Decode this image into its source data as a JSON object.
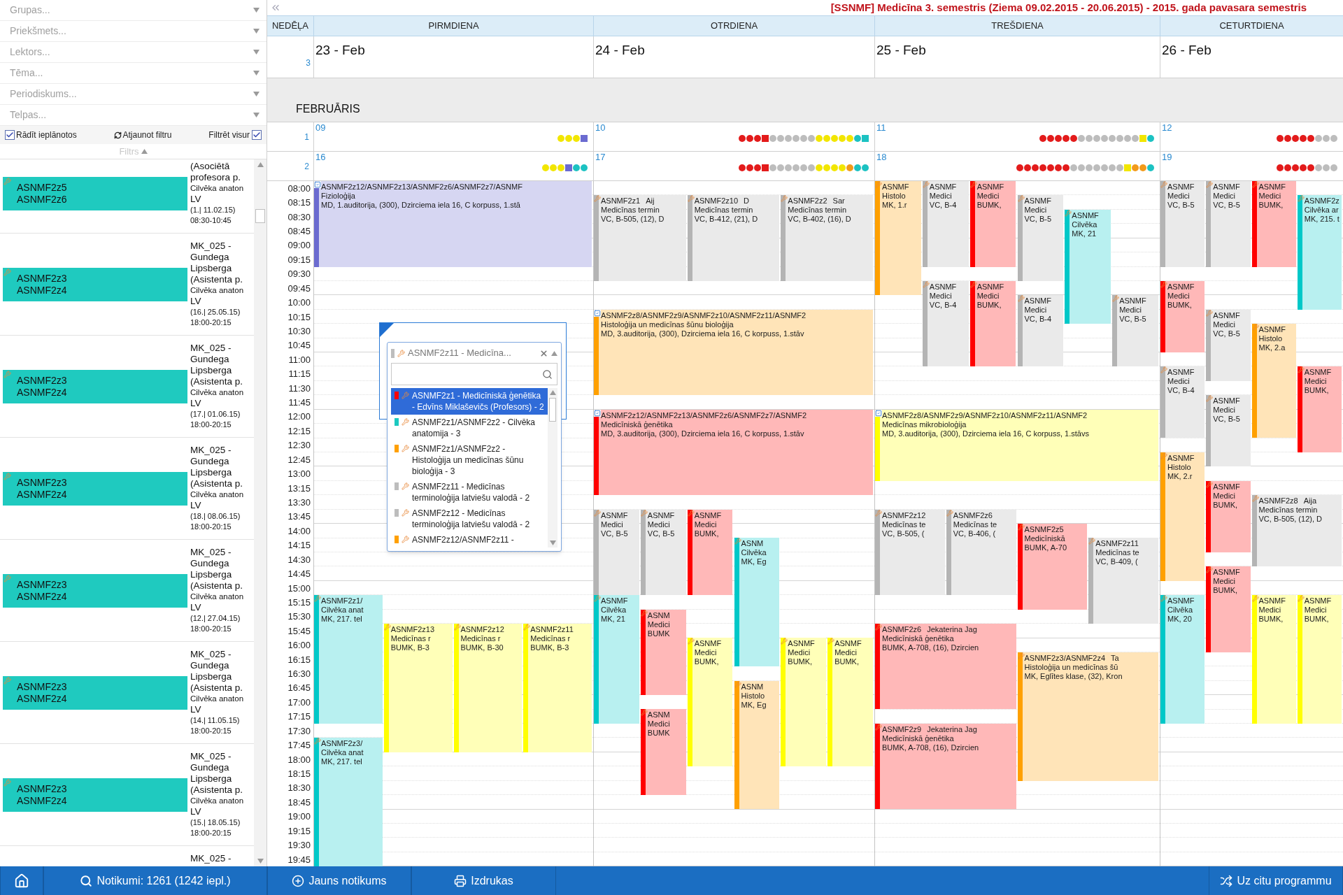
{
  "sidebar": {
    "filters": [
      {
        "placeholder": "Grupas..."
      },
      {
        "placeholder": "Priekšmets..."
      },
      {
        "placeholder": "Lektors..."
      },
      {
        "placeholder": "Tēma..."
      },
      {
        "placeholder": "Periodiskums..."
      },
      {
        "placeholder": "Telpas..."
      }
    ],
    "show_planned": {
      "label": "Rādīt ieplānotos",
      "checked": true
    },
    "refresh": {
      "label": "Atjaunot filtru"
    },
    "filter_everywhere": {
      "label": "Filtrēt visur",
      "checked": true
    },
    "filter_toggle": {
      "label": "Filtrs",
      "expanded": true
    },
    "events": [
      {
        "groups": [
          "ASNMF2z5",
          "ASNMF2z6"
        ],
        "header": [
          "(Asociētā",
          "profesora p."
        ],
        "subject": "Cilvēka anaton",
        "lang": "LV",
        "date": "(1.| 11.02.15)",
        "time": "08:30-10:45"
      },
      {
        "groups": [
          "ASNMF2z3",
          "ASNMF2z4"
        ],
        "header": [
          "MK_025 -",
          "Gundega",
          "Lipsberga",
          "(Asistenta p."
        ],
        "subject": "Cilvēka anaton",
        "lang": "LV",
        "date": "(16.| 25.05.15)",
        "time": "18:00-20:15"
      },
      {
        "groups": [
          "ASNMF2z3",
          "ASNMF2z4"
        ],
        "header": [
          "MK_025 -",
          "Gundega",
          "Lipsberga",
          "(Asistenta p."
        ],
        "subject": "Cilvēka anaton",
        "lang": "LV",
        "date": "(17.| 01.06.15)",
        "time": "18:00-20:15"
      },
      {
        "groups": [
          "ASNMF2z3",
          "ASNMF2z4"
        ],
        "header": [
          "MK_025 -",
          "Gundega",
          "Lipsberga",
          "(Asistenta p."
        ],
        "subject": "Cilvēka anaton",
        "lang": "LV",
        "date": "(18.| 08.06.15)",
        "time": "18:00-20:15"
      },
      {
        "groups": [
          "ASNMF2z3",
          "ASNMF2z4"
        ],
        "header": [
          "MK_025 -",
          "Gundega",
          "Lipsberga",
          "(Asistenta p."
        ],
        "subject": "Cilvēka anaton",
        "lang": "LV",
        "date": "(12.| 27.04.15)",
        "time": "18:00-20:15"
      },
      {
        "groups": [
          "ASNMF2z3",
          "ASNMF2z4"
        ],
        "header": [
          "MK_025 -",
          "Gundega",
          "Lipsberga",
          "(Asistenta p."
        ],
        "subject": "Cilvēka anaton",
        "lang": "LV",
        "date": "(14.| 11.05.15)",
        "time": "18:00-20:15"
      },
      {
        "groups": [
          "ASNMF2z3",
          "ASNMF2z4"
        ],
        "header": [
          "MK_025 -",
          "Gundega",
          "Lipsberga",
          "(Asistenta p."
        ],
        "subject": "Cilvēka anaton",
        "lang": "LV",
        "date": "(15.| 18.05.15)",
        "time": "18:00-20:15"
      },
      {
        "header": [
          "MK_025 -"
        ]
      }
    ]
  },
  "calendar": {
    "title": "[SSNMF] Medicīna 3. semestris (Ziema 09.02.2015 - 20.06.2015) - 2015. gada pavasara semestris",
    "week_header": "NEDĒĻA",
    "week_number": "3",
    "columns": [
      {
        "name": "PIRMDIENA",
        "date": "23 - Feb"
      },
      {
        "name": "OTRDIENA",
        "date": "24 - Feb"
      },
      {
        "name": "TREŠDIENA",
        "date": "25 - Feb"
      },
      {
        "name": "CETURTDIENA",
        "date": "26 - Feb"
      }
    ],
    "month": "FEBRUĀRIS",
    "weeks": [
      {
        "number": "1",
        "days": [
          {
            "date": "09",
            "dots": [
              {
                "color": "#f2e600",
                "kind": "circle"
              },
              {
                "color": "#f2e600",
                "kind": "circle"
              },
              {
                "color": "#f2e600",
                "kind": "circle"
              },
              {
                "color": "#6b6bd0",
                "kind": "square"
              }
            ]
          },
          {
            "date": "10",
            "dots": [
              {
                "color": "#e31b1b",
                "kind": "circle"
              },
              {
                "color": "#e31b1b",
                "kind": "circle"
              },
              {
                "color": "#e31b1b",
                "kind": "circle"
              },
              {
                "color": "#e31b1b",
                "kind": "square"
              },
              {
                "color": "#bdbdbd",
                "kind": "circle"
              },
              {
                "color": "#bdbdbd",
                "kind": "circle"
              },
              {
                "color": "#bdbdbd",
                "kind": "circle"
              },
              {
                "color": "#bdbdbd",
                "kind": "circle"
              },
              {
                "color": "#bdbdbd",
                "kind": "circle"
              },
              {
                "color": "#bdbdbd",
                "kind": "circle"
              },
              {
                "color": "#f2e600",
                "kind": "circle"
              },
              {
                "color": "#f2e600",
                "kind": "circle"
              },
              {
                "color": "#f2e600",
                "kind": "circle"
              },
              {
                "color": "#f2e600",
                "kind": "circle"
              },
              {
                "color": "#f2e600",
                "kind": "circle"
              },
              {
                "color": "#1cc2c2",
                "kind": "circle"
              },
              {
                "color": "#1cc2c2",
                "kind": "square"
              }
            ]
          },
          {
            "date": "11",
            "dots": [
              {
                "color": "#e31b1b",
                "kind": "circle"
              },
              {
                "color": "#e31b1b",
                "kind": "circle"
              },
              {
                "color": "#e31b1b",
                "kind": "circle"
              },
              {
                "color": "#e31b1b",
                "kind": "circle"
              },
              {
                "color": "#e31b1b",
                "kind": "circle"
              },
              {
                "color": "#bdbdbd",
                "kind": "circle"
              },
              {
                "color": "#bdbdbd",
                "kind": "circle"
              },
              {
                "color": "#bdbdbd",
                "kind": "circle"
              },
              {
                "color": "#bdbdbd",
                "kind": "circle"
              },
              {
                "color": "#bdbdbd",
                "kind": "circle"
              },
              {
                "color": "#bdbdbd",
                "kind": "circle"
              },
              {
                "color": "#bdbdbd",
                "kind": "circle"
              },
              {
                "color": "#bdbdbd",
                "kind": "circle"
              },
              {
                "color": "#f2e600",
                "kind": "square"
              },
              {
                "color": "#1cc2c2",
                "kind": "circle"
              }
            ]
          },
          {
            "date": "12",
            "dots": [
              {
                "color": "#e31b1b",
                "kind": "circle"
              },
              {
                "color": "#e31b1b",
                "kind": "circle"
              },
              {
                "color": "#e31b1b",
                "kind": "circle"
              },
              {
                "color": "#e31b1b",
                "kind": "circle"
              },
              {
                "color": "#e31b1b",
                "kind": "circle"
              },
              {
                "color": "#bdbdbd",
                "kind": "circle"
              },
              {
                "color": "#bdbdbd",
                "kind": "circle"
              },
              {
                "color": "#bdbdbd",
                "kind": "circle"
              }
            ]
          }
        ]
      },
      {
        "number": "2",
        "days": [
          {
            "date": "16",
            "dots": [
              {
                "color": "#f2e600",
                "kind": "circle"
              },
              {
                "color": "#f2e600",
                "kind": "circle"
              },
              {
                "color": "#f2e600",
                "kind": "circle"
              },
              {
                "color": "#6b6bd0",
                "kind": "square"
              },
              {
                "color": "#1cc2c2",
                "kind": "circle"
              },
              {
                "color": "#1cc2c2",
                "kind": "circle"
              }
            ]
          },
          {
            "date": "17",
            "dots": [
              {
                "color": "#e31b1b",
                "kind": "circle"
              },
              {
                "color": "#e31b1b",
                "kind": "circle"
              },
              {
                "color": "#e31b1b",
                "kind": "circle"
              },
              {
                "color": "#e31b1b",
                "kind": "square"
              },
              {
                "color": "#bdbdbd",
                "kind": "circle"
              },
              {
                "color": "#bdbdbd",
                "kind": "circle"
              },
              {
                "color": "#bdbdbd",
                "kind": "circle"
              },
              {
                "color": "#bdbdbd",
                "kind": "circle"
              },
              {
                "color": "#bdbdbd",
                "kind": "circle"
              },
              {
                "color": "#bdbdbd",
                "kind": "circle"
              },
              {
                "color": "#f2e600",
                "kind": "circle"
              },
              {
                "color": "#f2e600",
                "kind": "circle"
              },
              {
                "color": "#f2e600",
                "kind": "circle"
              },
              {
                "color": "#f2e600",
                "kind": "circle"
              },
              {
                "color": "#f29a1a",
                "kind": "circle"
              },
              {
                "color": "#1cc2c2",
                "kind": "circle"
              },
              {
                "color": "#1cc2c2",
                "kind": "circle"
              }
            ]
          },
          {
            "date": "18",
            "dots": [
              {
                "color": "#e31b1b",
                "kind": "circle"
              },
              {
                "color": "#e31b1b",
                "kind": "circle"
              },
              {
                "color": "#e31b1b",
                "kind": "circle"
              },
              {
                "color": "#e31b1b",
                "kind": "circle"
              },
              {
                "color": "#e31b1b",
                "kind": "circle"
              },
              {
                "color": "#e31b1b",
                "kind": "circle"
              },
              {
                "color": "#e31b1b",
                "kind": "circle"
              },
              {
                "color": "#bdbdbd",
                "kind": "circle"
              },
              {
                "color": "#bdbdbd",
                "kind": "circle"
              },
              {
                "color": "#bdbdbd",
                "kind": "circle"
              },
              {
                "color": "#bdbdbd",
                "kind": "circle"
              },
              {
                "color": "#bdbdbd",
                "kind": "circle"
              },
              {
                "color": "#bdbdbd",
                "kind": "circle"
              },
              {
                "color": "#bdbdbd",
                "kind": "circle"
              },
              {
                "color": "#f2e600",
                "kind": "square"
              },
              {
                "color": "#f29a1a",
                "kind": "circle"
              },
              {
                "color": "#f29a1a",
                "kind": "circle"
              },
              {
                "color": "#1cc2c2",
                "kind": "circle"
              }
            ]
          },
          {
            "date": "19",
            "dots": [
              {
                "color": "#e31b1b",
                "kind": "circle"
              },
              {
                "color": "#e31b1b",
                "kind": "circle"
              },
              {
                "color": "#e31b1b",
                "kind": "circle"
              },
              {
                "color": "#e31b1b",
                "kind": "circle"
              },
              {
                "color": "#e31b1b",
                "kind": "circle"
              },
              {
                "color": "#bdbdbd",
                "kind": "circle"
              },
              {
                "color": "#bdbdbd",
                "kind": "circle"
              },
              {
                "color": "#bdbdbd",
                "kind": "circle"
              }
            ]
          }
        ]
      }
    ],
    "times": [
      "08:00",
      "08:15",
      "08:30",
      "08:45",
      "09:00",
      "09:15",
      "09:30",
      "09:45",
      "10:00",
      "10:15",
      "10:30",
      "10:45",
      "11:00",
      "11:15",
      "11:30",
      "11:45",
      "12:00",
      "12:15",
      "12:30",
      "12:45",
      "13:00",
      "13:15",
      "13:30",
      "13:45",
      "14:00",
      "14:15",
      "14:30",
      "14:45",
      "15:00",
      "15:15",
      "15:30",
      "15:45",
      "16:00",
      "16:15",
      "16:30",
      "16:45",
      "17:00",
      "17:15",
      "17:30",
      "17:45",
      "18:00",
      "18:15",
      "18:30",
      "18:45",
      "19:00",
      "19:15",
      "19:30",
      "19:45"
    ],
    "days": [
      {
        "groups": [
          {
            "columns": [
              {
                "events": [
                  {
                    "kind": "lecture",
                    "color": "#6b6bd0",
                    "title": "ASNMF2z12/ASNMF2z13/ASNMF2z6/ASNMF2z7/ASNMF",
                    "lines": [
                      "Fizioloģija",
                      "MD, 1.auditorija, (300), Dzirciema iela 16, C korpuss, 1.stā"
                    ]
                  }
                ]
              }
            ]
          },
          {
            "columns": [
              {
                "events": [
                  {
                    "kind": "class",
                    "color": "#00c8c8",
                    "title": "ASNMF2z1/",
                    "lines": [
                      "Cilvēka anat",
                      "MK, 217. tel"
                    ]
                  },
                  {
                    "kind": "class",
                    "color": "#00c8c8",
                    "title": "ASNMF2z3/",
                    "lines": [
                      "Cilvēka anat",
                      "MK, 217. tel"
                    ]
                  }
                ]
              },
              {
                "events": [
                  {
                    "kind": "class",
                    "color": "#ffff00",
                    "title": "ASNMF2z13",
                    "lines": [
                      "Medicīnas r",
                      "BUMK, B-3"
                    ]
                  }
                ]
              },
              {
                "events": [
                  {
                    "kind": "class",
                    "color": "#ffff00",
                    "title": "ASNMF2z12",
                    "lines": [
                      "Medicīnas r",
                      "BUMK, B-30"
                    ]
                  }
                ]
              },
              {
                "events": [
                  {
                    "kind": "class",
                    "color": "#ffff00",
                    "title": "ASNMF2z11",
                    "lines": [
                      "Medicīnas r",
                      "BUMK, B-3"
                    ]
                  }
                ]
              }
            ]
          }
        ]
      },
      {
        "groups": [
          {
            "columns": [
              {
                "events": [
                  {
                    "kind": "class",
                    "color": "#b4b4b4",
                    "title": "ASNMF2z1",
                    "teacher": "Aij",
                    "lines": [
                      "Medicīnas termin",
                      "VC, B-505, (12), D"
                    ]
                  }
                ]
              },
              {
                "events": [
                  {
                    "kind": "class",
                    "color": "#b4b4b4",
                    "title": "ASNMF2z10",
                    "teacher": "D",
                    "lines": [
                      "Medicīnas termin",
                      "VC, B-412, (21), D"
                    ]
                  }
                ]
              },
              {
                "events": [
                  {
                    "kind": "class",
                    "color": "#b4b4b4",
                    "title": "ASNMF2z2",
                    "teacher": "Sar",
                    "lines": [
                      "Medicīnas termin",
                      "VC, B-402, (16), D"
                    ]
                  }
                ]
              }
            ]
          },
          {
            "columns": [
              {
                "events": [
                  {
                    "kind": "lecture",
                    "color": "#ffa000",
                    "title": "ASNMF2z8/ASNMF2z9/ASNMF2z10/ASNMF2z11/ASNMF2",
                    "lines": [
                      "Histoloģija un medicīnas šūnu bioloģija",
                      "MD, 3.auditorija, (300), Dzirciema iela 16, C korpuss, 1.stāv"
                    ]
                  },
                  {
                    "kind": "lecture",
                    "color": "#ff0000",
                    "title": "ASNMF2z12/ASNMF2z13/ASNMF2z6/ASNMF2z7/ASNMF2",
                    "lines": [
                      "Medicīniskā ģenētika",
                      "MD, 3.auditorija, (300), Dzirciema iela 16, C korpuss, 1.stāv"
                    ]
                  }
                ]
              }
            ]
          },
          {
            "columns": [
              {
                "events": [
                  {
                    "kind": "class",
                    "color": "#b4b4b4",
                    "title": "ASNMF",
                    "lines": [
                      "Medici",
                      "VC, B-5"
                    ]
                  },
                  {
                    "kind": "class",
                    "color": "#00c8c8",
                    "title": "ASNMF",
                    "lines": [
                      "Cilvēka",
                      "MK, 21"
                    ]
                  }
                ]
              },
              {
                "events": [
                  {
                    "kind": "class",
                    "color": "#b4b4b4",
                    "title": "ASNMF",
                    "lines": [
                      "Medici",
                      "VC, B-5"
                    ]
                  },
                  {
                    "kind": "class",
                    "color": "#ff0000",
                    "title": "ASNM",
                    "lines": [
                      "Medici",
                      "BUMK"
                    ]
                  },
                  {
                    "kind": "class",
                    "color": "#ff0000",
                    "title": "ASNM",
                    "lines": [
                      "Medici",
                      "BUMK"
                    ]
                  }
                ]
              },
              {
                "events": [
                  {
                    "kind": "class",
                    "color": "#ff0000",
                    "title": "ASNMF",
                    "lines": [
                      "Medici",
                      "BUMK,"
                    ]
                  },
                  {
                    "kind": "class",
                    "color": "#ffff00",
                    "title": "ASNMF",
                    "lines": [
                      "Medici",
                      "BUMK,"
                    ]
                  }
                ]
              },
              {
                "events": [
                  {
                    "kind": "class",
                    "color": "#00c8c8",
                    "title": "ASNM",
                    "lines": [
                      "Cilvēka",
                      "MK, Eg"
                    ]
                  },
                  {
                    "kind": "class",
                    "color": "#ffa000",
                    "title": "ASNM",
                    "lines": [
                      "Histolo",
                      "MK, Eg"
                    ]
                  }
                ]
              },
              {
                "events": [
                  {
                    "kind": "class",
                    "color": "#ffff00",
                    "title": "ASNMF",
                    "lines": [
                      "Medici",
                      "BUMK,"
                    ]
                  }
                ]
              },
              {
                "events": [
                  {
                    "kind": "class",
                    "color": "#ffff00",
                    "title": "ASNMF",
                    "lines": [
                      "Medici",
                      "BUMK,"
                    ]
                  }
                ]
              }
            ]
          }
        ]
      },
      {
        "groups": [
          {
            "columns": [
              {
                "events": [
                  {
                    "kind": "class",
                    "color": "#ffa000",
                    "title": "ASNMF",
                    "lines": [
                      "Histolo",
                      "MK, 1.r"
                    ]
                  }
                ]
              },
              {
                "events": [
                  {
                    "kind": "class",
                    "color": "#b4b4b4",
                    "title": "ASNMF",
                    "lines": [
                      "Medici",
                      "VC, B-4"
                    ]
                  },
                  {
                    "kind": "class",
                    "color": "#b4b4b4",
                    "title": "ASNMF",
                    "lines": [
                      "Medici",
                      "VC, B-4"
                    ]
                  }
                ]
              },
              {
                "events": [
                  {
                    "kind": "class",
                    "color": "#ff0000",
                    "title": "ASNMF",
                    "lines": [
                      "Medici",
                      "BUMK,"
                    ]
                  },
                  {
                    "kind": "class",
                    "color": "#ff0000",
                    "title": "ASNMF",
                    "lines": [
                      "Medici",
                      "BUMK,"
                    ]
                  }
                ]
              },
              {
                "events": [
                  {
                    "kind": "class",
                    "color": "#b4b4b4",
                    "title": "ASNMF",
                    "lines": [
                      "Medici",
                      "VC, B-5"
                    ]
                  },
                  {
                    "kind": "class",
                    "color": "#b4b4b4",
                    "title": "ASNMF",
                    "lines": [
                      "Medici",
                      "VC, B-4"
                    ]
                  }
                ]
              },
              {
                "events": [
                  {
                    "kind": "class",
                    "color": "#00c8c8",
                    "title": "ASNMF",
                    "lines": [
                      "Cilvēka",
                      "MK, 21"
                    ]
                  }
                ]
              },
              {
                "events": [
                  {
                    "kind": "class",
                    "color": "#b4b4b4",
                    "title": "ASNMF",
                    "lines": [
                      "Medici",
                      "VC, B-5"
                    ]
                  }
                ]
              }
            ]
          },
          {
            "columns": [
              {
                "events": [
                  {
                    "kind": "lecture",
                    "color": "#ffff00",
                    "title": "ASNMF2z8/ASNMF2z9/ASNMF2z10/ASNMF2z11/ASNMF2",
                    "lines": [
                      "Medicīnas mikrobioloģija",
                      "MD, 3.auditorija, (300), Dzirciema iela 16, C korpuss, 1.stāvs"
                    ]
                  }
                ]
              }
            ]
          },
          {
            "columns": [
              {
                "events": [
                  {
                    "kind": "class",
                    "color": "#b4b4b4",
                    "title": "ASNMF2z12",
                    "lines": [
                      "Medicīnas te",
                      "VC, B-505, ("
                    ]
                  }
                ]
              },
              {
                "events": [
                  {
                    "kind": "class",
                    "color": "#b4b4b4",
                    "title": "ASNMF2z6",
                    "lines": [
                      "Medicīnas te",
                      "VC, B-406, ("
                    ]
                  }
                ]
              },
              {
                "events": [
                  {
                    "kind": "class",
                    "color": "#ff0000",
                    "title": "ASNMF2z5",
                    "lines": [
                      "Medicīniskā",
                      "BUMK, A-70"
                    ]
                  }
                ]
              },
              {
                "events": [
                  {
                    "kind": "class",
                    "color": "#b4b4b4",
                    "title": "ASNMF2z11",
                    "lines": [
                      "Medicīnas te",
                      "VC, B-409, ("
                    ]
                  }
                ]
              }
            ]
          },
          {
            "columns": [
              {
                "events": [
                  {
                    "kind": "class",
                    "color": "#ff0000",
                    "title": "ASNMF2z6",
                    "teacher": "Jekaterina Jag",
                    "lines": [
                      "Medicīniskā ģenētika",
                      "BUMK, A-708, (16), Dzircien"
                    ]
                  },
                  {
                    "kind": "class",
                    "color": "#ff0000",
                    "title": "ASNMF2z9",
                    "teacher": "Jekaterina Jag",
                    "lines": [
                      "Medicīniskā ģenētika",
                      "BUMK, A-708, (16), Dzircien"
                    ]
                  }
                ]
              },
              {
                "events": [
                  {
                    "kind": "class",
                    "color": "#ffa000",
                    "title": "ASNMF2z3/ASNMF2z4",
                    "teacher": "Ta",
                    "lines": [
                      "Histoloģija un medicīnas šū",
                      "MK, Eglītes klase, (32), Kron"
                    ]
                  }
                ]
              }
            ]
          }
        ]
      },
      {
        "groups": [
          {
            "columns": [
              {
                "events": [
                  {
                    "kind": "class",
                    "color": "#b4b4b4",
                    "title": "ASNMF",
                    "lines": [
                      "Medici",
                      "VC, B-5"
                    ]
                  },
                  {
                    "kind": "class",
                    "color": "#ff0000",
                    "title": "ASNMF",
                    "lines": [
                      "Medici",
                      "BUMK,"
                    ]
                  },
                  {
                    "kind": "class",
                    "color": "#b4b4b4",
                    "title": "ASNMF",
                    "lines": [
                      "Medici",
                      "VC, B-4"
                    ]
                  },
                  {
                    "kind": "class",
                    "color": "#ffa000",
                    "title": "ASNMF",
                    "lines": [
                      "Histolo",
                      "MK, 2.r"
                    ]
                  },
                  {
                    "kind": "class",
                    "color": "#00c8c8",
                    "title": "ASNMF",
                    "lines": [
                      "Cilvēka",
                      "MK, 20"
                    ]
                  }
                ]
              },
              {
                "events": [
                  {
                    "kind": "class",
                    "color": "#b4b4b4",
                    "title": "ASNMF",
                    "lines": [
                      "Medici",
                      "VC, B-5"
                    ]
                  },
                  {
                    "kind": "class",
                    "color": "#b4b4b4",
                    "title": "ASNMF",
                    "lines": [
                      "Medici",
                      "VC, B-5"
                    ]
                  },
                  {
                    "kind": "class",
                    "color": "#b4b4b4",
                    "title": "ASNMF",
                    "lines": [
                      "Medici",
                      "VC, B-5"
                    ]
                  },
                  {
                    "kind": "class",
                    "color": "#ff0000",
                    "title": "ASNMF",
                    "lines": [
                      "Medici",
                      "BUMK,"
                    ]
                  },
                  {
                    "kind": "class",
                    "color": "#ff0000",
                    "title": "ASNMF",
                    "lines": [
                      "Medici",
                      "BUMK,"
                    ]
                  }
                ]
              },
              {
                "events": [
                  {
                    "kind": "class",
                    "color": "#ff0000",
                    "title": "ASNMF",
                    "lines": [
                      "Medici",
                      "BUMK,"
                    ]
                  },
                  {
                    "kind": "class",
                    "color": "#ffa000",
                    "title": "ASNMF",
                    "lines": [
                      "Histolo",
                      "MK, 2.a"
                    ]
                  },
                  {
                    "kind": "class",
                    "color": "#b4b4b4",
                    "title": "ASNMF2z8",
                    "teacher": "Aija",
                    "lines": [
                      "Medicīnas termin",
                      "VC, B-505, (12), D"
                    ]
                  },
                  {
                    "kind": "class",
                    "color": "#ffff00",
                    "title": "ASNMF",
                    "lines": [
                      "Medici",
                      "BUMK,"
                    ]
                  }
                ]
              },
              {
                "events": [
                  {
                    "kind": "class",
                    "color": "#00c8c8",
                    "title": "ASNMF2z",
                    "lines": [
                      "Cilvēka ar",
                      "MK, 215. t"
                    ]
                  },
                  {
                    "kind": "class",
                    "color": "#ff0000",
                    "title": "ASNMF",
                    "lines": [
                      "Medici",
                      "BUMK,"
                    ]
                  },
                  {
                    "kind": "class",
                    "color": "#ffff00",
                    "title": "ASNMF",
                    "lines": [
                      "Medici",
                      "BUMK,"
                    ]
                  }
                ]
              }
            ]
          }
        ]
      }
    ]
  },
  "popup": {
    "value": {
      "text": "ASNMF2z11 - Medicīna...",
      "color": "#bdbdbd"
    },
    "options": [
      {
        "text": "ASNMF2z1 - Medicīniskā ģenētika - Edvīns Miklaševičs (Profesors) - 2",
        "color": "#ff0000",
        "selected": true
      },
      {
        "text": "ASNMF2z1/ASNMF2z2 - Cilvēka anatomija - 3",
        "color": "#1cc9c0",
        "selected": false
      },
      {
        "text": "ASNMF2z1/ASNMF2z2 - Histoloģija un medicīnas šūnu bioloģija - 3",
        "color": "#ffa000",
        "selected": false
      },
      {
        "text": "ASNMF2z11 - Medicīnas terminoloģija latviešu valodā - 2",
        "color": "#bdbdbd",
        "selected": false
      },
      {
        "text": "ASNMF2z12 - Medicīnas terminoloģija latviešu valodā - 2",
        "color": "#bdbdbd",
        "selected": false
      },
      {
        "text": "ASNMF2z12/ASNMF2z11 -",
        "color": "#ffa000",
        "selected": false
      }
    ]
  },
  "bottom_bar": {
    "items": [
      {
        "kind": "home"
      },
      {
        "kind": "search",
        "label": "Notikumi: 1261 (1242 iepl.)"
      },
      {
        "kind": "new",
        "label": "Jauns notikums"
      },
      {
        "kind": "print",
        "label": "Izdrukas"
      },
      {
        "kind": "switch",
        "label": "Uz citu programmu"
      }
    ]
  }
}
